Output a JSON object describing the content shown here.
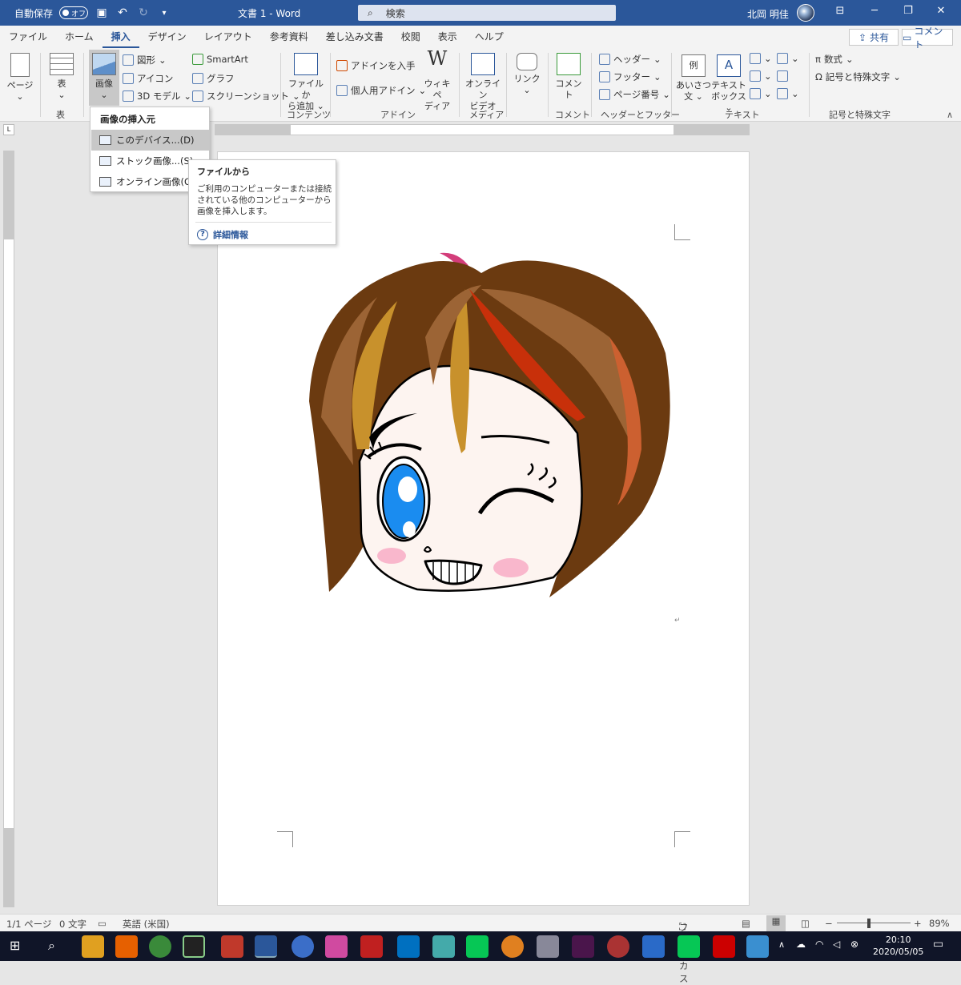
{
  "titlebar": {
    "autosave_label": "自動保存",
    "autosave_state": "オフ",
    "doc_title": "文書 1  -  Word",
    "search_placeholder": "検索",
    "user_name": "北岡 明佳"
  },
  "tabs": [
    "ファイル",
    "ホーム",
    "挿入",
    "デザイン",
    "レイアウト",
    "参考資料",
    "差し込み文書",
    "校閲",
    "表示",
    "ヘルプ"
  ],
  "active_tab": "挿入",
  "actions": {
    "share": "共有",
    "comments": "コメント"
  },
  "ribbon": {
    "pages": "ページ",
    "table": "表",
    "table_group": "表",
    "image": "画像",
    "shapes": "図形",
    "icons": "アイコン",
    "model3d": "3D モデル",
    "smartart": "SmartArt",
    "chart": "グラフ",
    "screenshot": "スクリーンショット",
    "file_add_1": "ファイルか",
    "file_add_2": "ら追加",
    "content_group": "コンテンツ",
    "get_addins": "アドインを入手",
    "my_addins": "個人用アドイン",
    "wiki_1": "ウィキペ",
    "wiki_2": "ディア",
    "addin_group": "アドイン",
    "online_video_1": "オンライン",
    "online_video_2": "ビデオ",
    "media_group": "メディア",
    "link": "リンク",
    "comment": "コメント",
    "comment_group": "コメント",
    "header": "ヘッダー",
    "footer": "フッター",
    "page_number": "ページ番号",
    "hf_group": "ヘッダーとフッター",
    "greeting_1": "あいさつ",
    "greeting_2": "文",
    "textbox_1": "テキスト",
    "textbox_2": "ボックス",
    "text_group": "テキスト",
    "equation": "数式",
    "symbol": "記号と特殊文字",
    "symbol_group": "記号と特殊文字",
    "greeting_icon_text": "例",
    "textbox_icon_text": "A",
    "wiki_icon_text": "W"
  },
  "dropdown": {
    "header": "画像の挿入元",
    "items": [
      "このデバイス...(D)",
      "ストック画像...(S)",
      "オンライン画像(O)..."
    ]
  },
  "tooltip": {
    "title": "ファイルから",
    "body": "ご利用のコンピューターまたは接続されている他のコンピューターから画像を挿入します。",
    "link": "詳細情報"
  },
  "statusbar": {
    "page": "1/1 ページ",
    "words": "0 文字",
    "language": "英語 (米国)",
    "focus": "フォーカス",
    "zoom": "89%"
  },
  "clock": {
    "time": "20:10",
    "date": "2020/05/05"
  },
  "colors": {
    "accent": "#2b579a",
    "hair": "#6b3a10",
    "hair_light": "#9c6435",
    "hair_gold": "#c8912c",
    "hair_red": "#c8300a",
    "skin": "#fdf4f0",
    "eye": "#1a8cf0"
  }
}
